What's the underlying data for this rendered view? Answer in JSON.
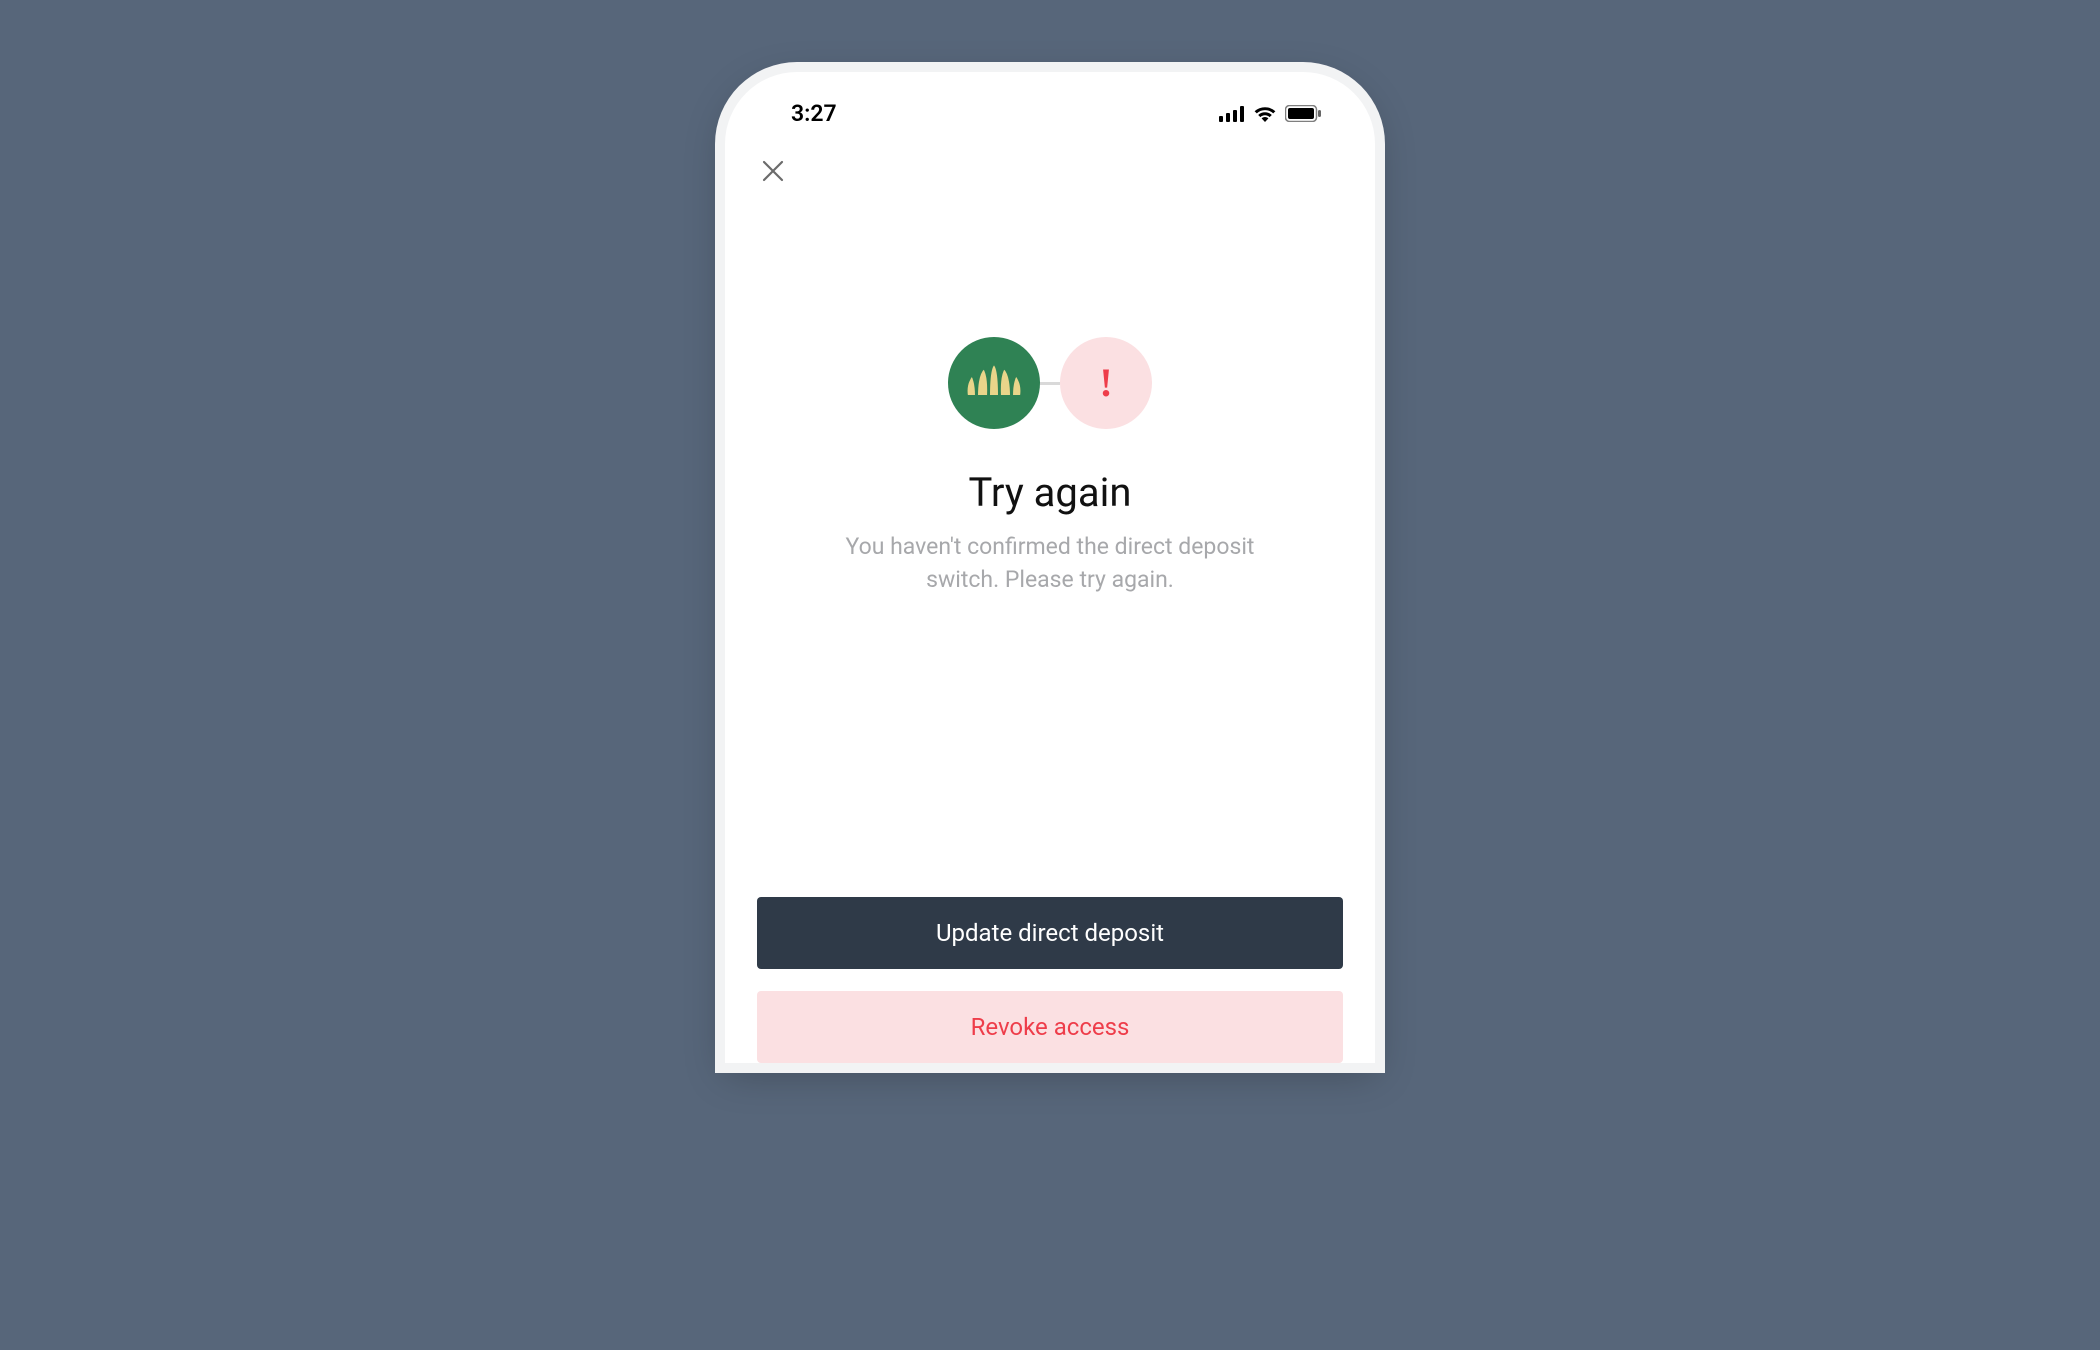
{
  "status_bar": {
    "time": "3:27"
  },
  "nav": {
    "close_label": "Close"
  },
  "hero": {
    "title": "Try again",
    "subtitle": "You haven't confirmed the direct deposit switch. Please try again.",
    "error_glyph": "!"
  },
  "buttons": {
    "primary": "Update direct deposit",
    "danger": "Revoke access"
  },
  "colors": {
    "page_bg": "#57667a",
    "brand_green": "#2f8254",
    "error_pink": "#fbe0e2",
    "error_red": "#ee3d4a",
    "primary_btn": "#2f3a48"
  }
}
